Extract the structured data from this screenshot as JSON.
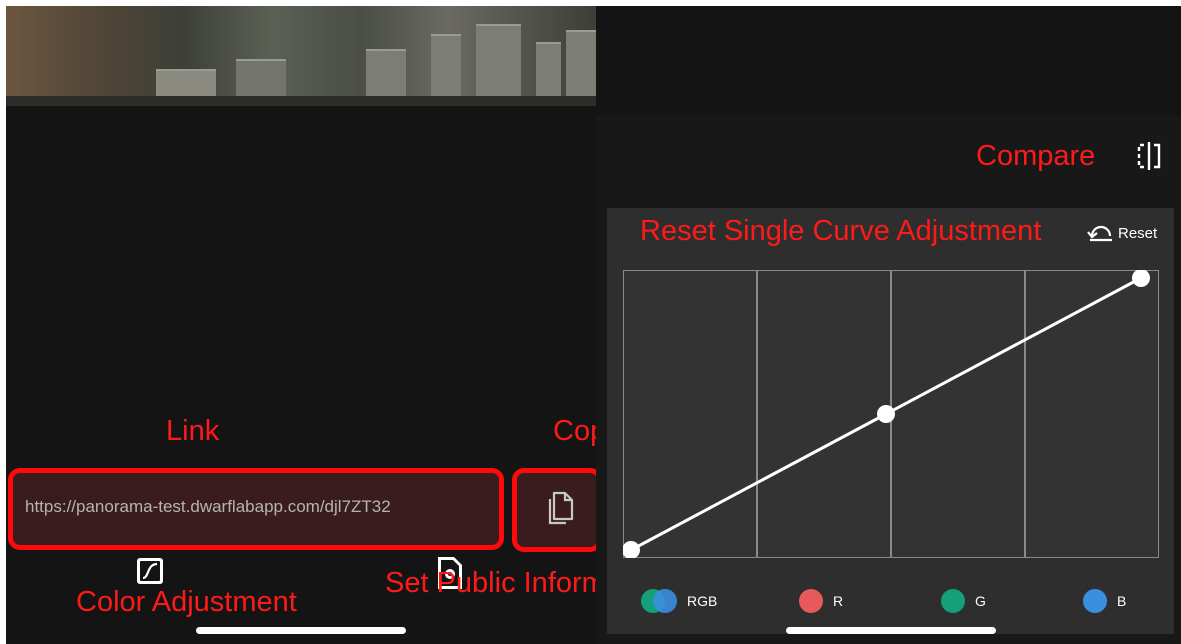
{
  "annotations": {
    "compare": "Compare",
    "reset_curve": "Reset Single Curve Adjustment",
    "link": "Link",
    "copy": "Copy",
    "color_adjustment": "Color Adjustment",
    "set_public_info": "Set Public Information"
  },
  "share": {
    "url": "https://panorama-test.dwarflabapp.com/djl7ZT32"
  },
  "curve_panel": {
    "reset_label": "Reset",
    "channels": [
      {
        "label": "RGB",
        "color": "#1a8f6b"
      },
      {
        "label": "R",
        "color": "#e85a5a"
      },
      {
        "label": "G",
        "color": "#15a07a"
      },
      {
        "label": "B",
        "color": "#3a8fe0"
      }
    ],
    "curve_points": [
      [
        0,
        0
      ],
      [
        0.5,
        0.5
      ],
      [
        1,
        1
      ]
    ]
  },
  "colors": {
    "annotation_red": "#ff1a1a",
    "panel_bg": "#2e2e2e"
  },
  "icons": [
    "compare-icon",
    "reset-icon",
    "copy-icon",
    "color-adjustment-icon",
    "settings-document-icon"
  ]
}
